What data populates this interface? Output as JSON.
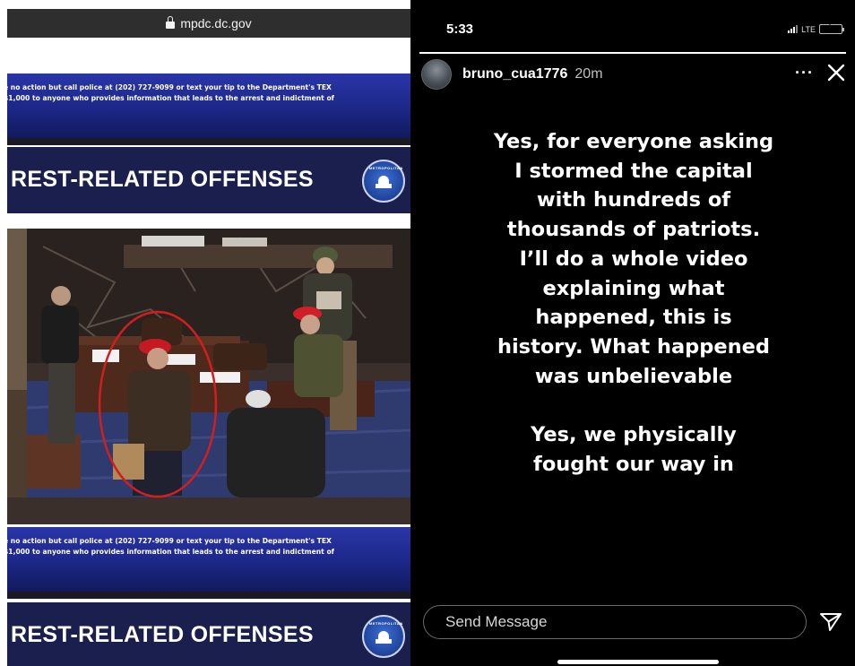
{
  "left_panel": {
    "url": "mpdc.dc.gov",
    "tip_banner": {
      "line1": "e no action but call police at (202) 727-9099 or text your tip to the Department's TEX",
      "line2": "$1,000 to anyone who provides information that leads to the arrest and indictment of"
    },
    "offense_banner": {
      "text": "REST-RELATED OFFENSES"
    },
    "photo_annotation_color": "#d11f1f"
  },
  "story": {
    "status": {
      "time": "5:33",
      "network": "LTE"
    },
    "progress": {
      "total_segments": 1,
      "completed": 1
    },
    "header": {
      "username": "bruno_cua1776",
      "time_ago": "20m",
      "more_icon": "ellipsis-icon",
      "close_icon": "close-icon"
    },
    "text_lines": [
      "Yes, for everyone asking",
      "I stormed the capital",
      "with hundreds of",
      "thousands of patriots.",
      "I’ll do a whole video",
      "explaining what",
      "happened, this is",
      "history. What happened",
      "was unbelievable",
      "",
      "Yes, we physically",
      "fought our way in"
    ],
    "reply": {
      "placeholder": "Send Message",
      "send_icon": "paper-plane-icon"
    }
  },
  "colors": {
    "banner_blue": "#1c2787",
    "offense_navy": "#1b1f4d",
    "story_background": "#000000",
    "battery_green": "#34c84a"
  }
}
